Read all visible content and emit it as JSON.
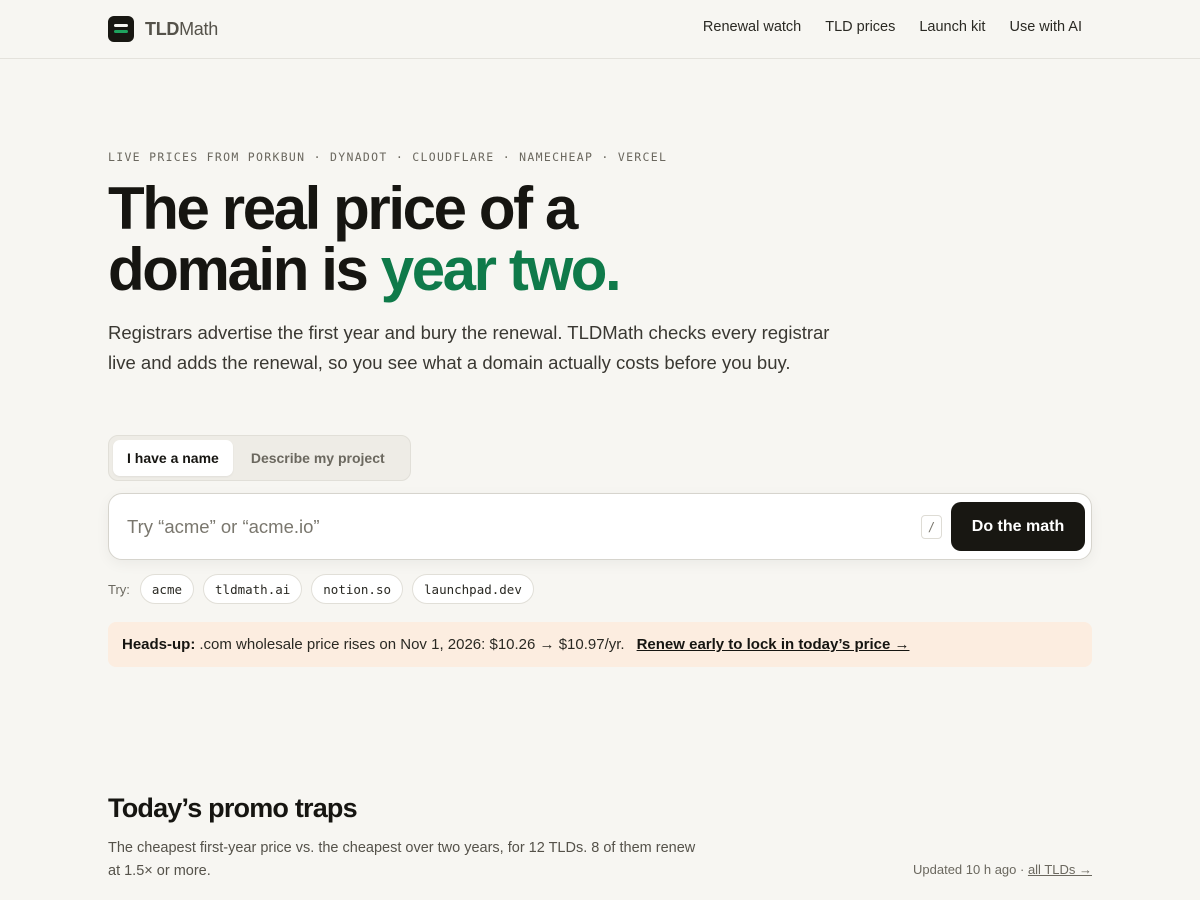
{
  "header": {
    "logo_bold": "TLD",
    "logo_rest": "Math",
    "nav": [
      {
        "label": "Renewal watch"
      },
      {
        "label": "TLD prices"
      },
      {
        "label": "Launch kit"
      },
      {
        "label": "Use with AI"
      }
    ]
  },
  "hero": {
    "eyebrow": "LIVE PRICES FROM PORKBUN · DYNADOT · CLOUDFLARE · NAMECHEAP · VERCEL",
    "headline_line1": "The real price of a",
    "headline_line2_start": "domain is ",
    "headline_accent": "year two.",
    "subcopy": "Registrars advertise the first year and bury the renewal. TLDMath checks every registrar live and adds the renewal, so you see what a domain actually costs before you buy."
  },
  "mode_tabs": [
    {
      "label": "I have a name",
      "active": true
    },
    {
      "label": "Describe my project",
      "active": false
    }
  ],
  "search": {
    "value": "",
    "placeholder": "Try “acme” or “acme.io”",
    "shortcut": "/",
    "button_label": "Do the math"
  },
  "try": {
    "label": "Try:",
    "chips": [
      "acme",
      "tldmath.ai",
      "notion.so",
      "launchpad.dev"
    ]
  },
  "alert": {
    "prefix": "Heads-up:",
    "message": ".com wholesale price rises on Nov 1, 2026: $10.26 → $10.97/yr.",
    "link": "Renew early to lock in today’s price →"
  },
  "section": {
    "title": "Today’s promo traps",
    "description": "The cheapest first-year price vs. the cheapest over two years, for 12 TLDs. 8 of them renew at 1.5× or more.",
    "updated_text": "Updated 10 h ago · ",
    "all_link": "all TLDs →"
  },
  "colors": {
    "background": "#f7f6f2",
    "accent_green": "#0f7a4a",
    "alert_bg": "#fcede0",
    "button_dark": "#181712"
  },
  "icons": {
    "logo": "tldmath-logo-icon"
  }
}
